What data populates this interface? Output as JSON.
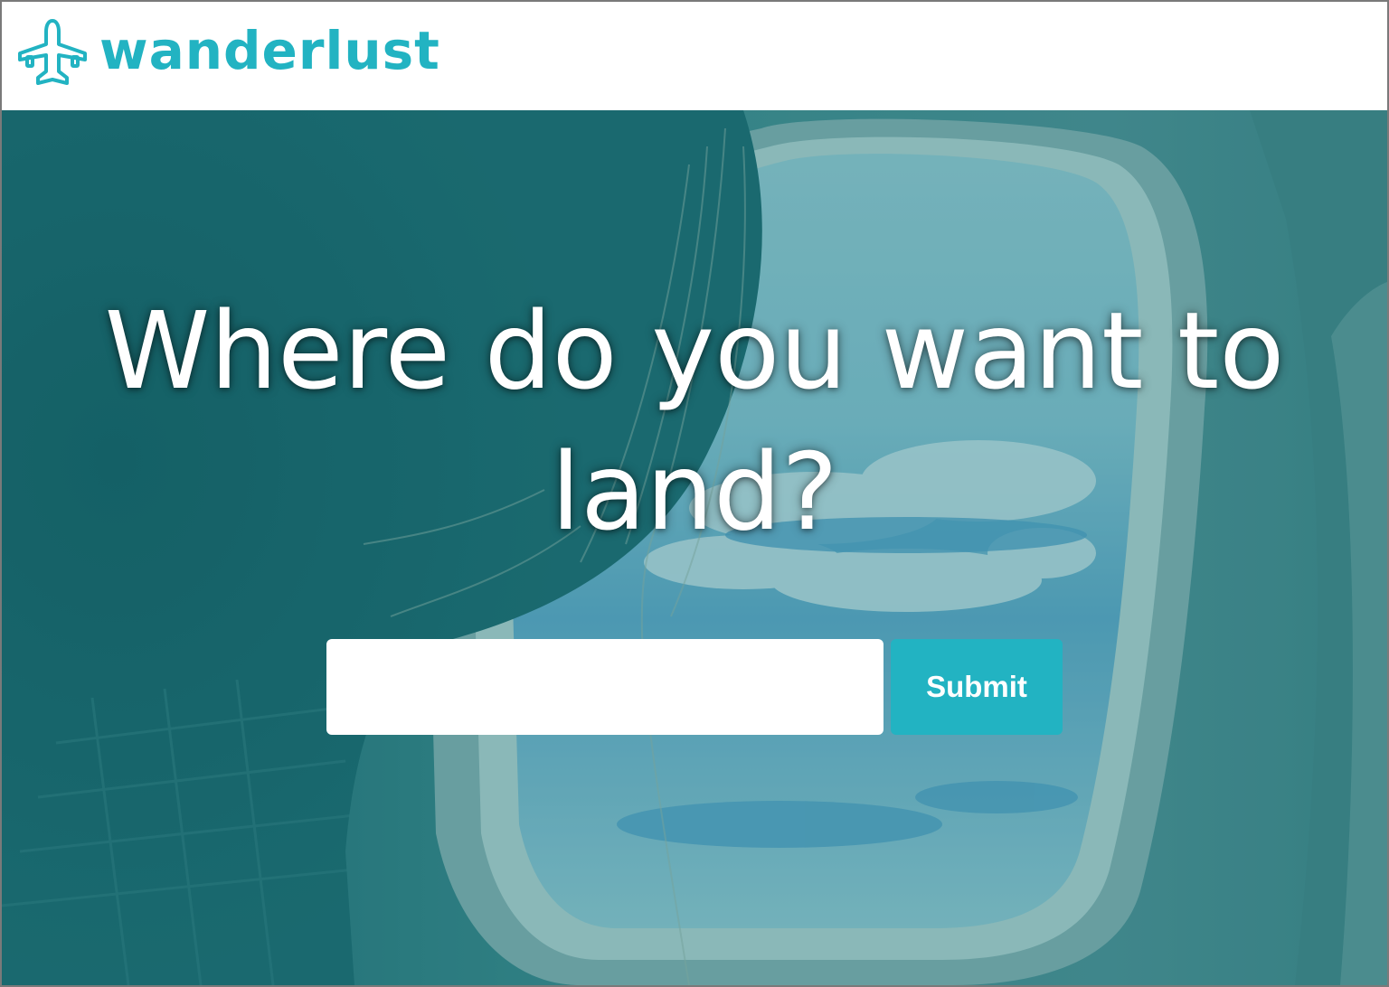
{
  "header": {
    "brand_name": "wanderlust",
    "brand_icon": "airplane-icon"
  },
  "hero": {
    "background_image": "person-looking-out-airplane-window",
    "headline": "Where do you want to land?",
    "search": {
      "value": "",
      "placeholder": ""
    },
    "submit_label": "Submit"
  },
  "colors": {
    "brand": "#22b3c2",
    "overlay": "#1b6b70",
    "headline_text": "#ffffff"
  }
}
